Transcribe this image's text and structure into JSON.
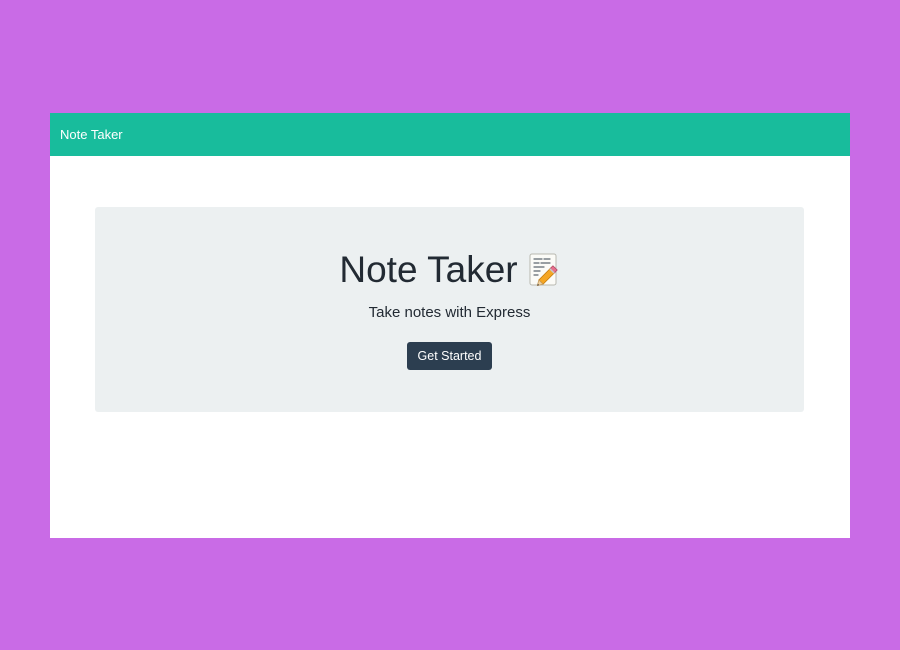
{
  "navbar": {
    "brand": "Note Taker"
  },
  "hero": {
    "title": "Note Taker",
    "title_icon": "memo-pencil-icon",
    "subtitle": "Take notes with Express",
    "cta_label": "Get Started"
  },
  "colors": {
    "page_background": "#c96be6",
    "navbar": "#18bc9c",
    "jumbotron": "#ecf0f1",
    "button": "#2c3e50"
  }
}
